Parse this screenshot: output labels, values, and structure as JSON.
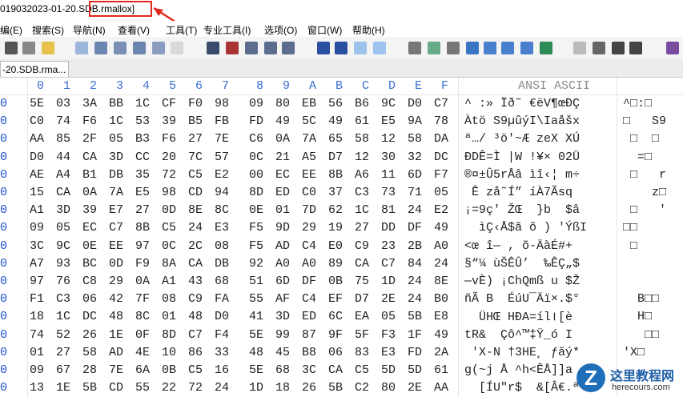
{
  "window": {
    "title": "019032023-01-20.SDB.rmallox]",
    "highlighted_text": "SDB.rmallox]"
  },
  "menu": [
    "编(E)",
    "搜索(S)",
    "导航(N)",
    "查看(V)",
    "工具(T)",
    "专业工具(I)",
    "选项(O)",
    "窗口(W)",
    "帮助(H)"
  ],
  "tab": {
    "label": "-20.SDB.rma..."
  },
  "hex_header": [
    "0",
    "1",
    "2",
    "3",
    "4",
    "5",
    "6",
    "7",
    "8",
    "9",
    "A",
    "B",
    "C",
    "D",
    "E",
    "F"
  ],
  "ascii_header": "ANSI ASCII",
  "rows": [
    {
      "offset": "0",
      "hex": [
        "5E",
        "03",
        "3A",
        "BB",
        "1C",
        "CF",
        "F0",
        "98",
        "09",
        "80",
        "EB",
        "56",
        "B6",
        "9C",
        "D0",
        "C7"
      ],
      "ansi": "^ :» Ïð˜ €ëV¶œÐÇ",
      "ascii": "^□:□"
    },
    {
      "offset": "0",
      "hex": [
        "C0",
        "74",
        "F6",
        "1C",
        "53",
        "39",
        "B5",
        "FB",
        "FD",
        "49",
        "5C",
        "49",
        "61",
        "E5",
        "9A",
        "78"
      ],
      "ansi": "Àtö S9µûýI\\Iaåšx",
      "ascii": "□   S9"
    },
    {
      "offset": "0",
      "hex": [
        "AA",
        "85",
        "2F",
        "05",
        "B3",
        "F6",
        "27",
        "7E",
        "C6",
        "0A",
        "7A",
        "65",
        "58",
        "12",
        "58",
        "DA"
      ],
      "ansi": "ª…/ ³ö'~Æ zeX XÚ",
      "ascii": " □  □"
    },
    {
      "offset": "0",
      "hex": [
        "D0",
        "44",
        "CA",
        "3D",
        "CC",
        "20",
        "7C",
        "57",
        "0C",
        "21",
        "A5",
        "D7",
        "12",
        "30",
        "32",
        "DC"
      ],
      "ansi": "ÐDÊ=Ì |W !¥× 02Ü",
      "ascii": "  =□"
    },
    {
      "offset": "0",
      "hex": [
        "AE",
        "A4",
        "B1",
        "DB",
        "35",
        "72",
        "C5",
        "E2",
        "00",
        "EC",
        "EE",
        "8B",
        "A6",
        "11",
        "6D",
        "F7"
      ],
      "ansi": "®¤±Û5rÅâ ìî‹¦ m÷",
      "ascii": " □   r"
    },
    {
      "offset": "0",
      "hex": [
        "15",
        "CA",
        "0A",
        "7A",
        "E5",
        "98",
        "CD",
        "94",
        "8D",
        "ED",
        "C0",
        "37",
        "C3",
        "73",
        "71",
        "05"
      ],
      "ansi": " Ê zå˜Í” íÀ7Ãsq ",
      "ascii": "    z□"
    },
    {
      "offset": "0",
      "hex": [
        "A1",
        "3D",
        "39",
        "E7",
        "27",
        "0D",
        "8E",
        "8C",
        "0E",
        "01",
        "7D",
        "62",
        "1C",
        "81",
        "24",
        "E2"
      ],
      "ansi": "¡=9ç' ŽŒ  }b  $â",
      "ascii": " □   '"
    },
    {
      "offset": "0",
      "hex": [
        "09",
        "05",
        "EC",
        "C7",
        "8B",
        "C5",
        "24",
        "E3",
        "F5",
        "9D",
        "29",
        "19",
        "27",
        "DD",
        "DF",
        "49"
      ],
      "ansi": "  ìÇ‹Å$ã õ ) 'ÝßI",
      "ascii": "□□"
    },
    {
      "offset": "0",
      "hex": [
        "3C",
        "9C",
        "0E",
        "EE",
        "97",
        "0C",
        "2C",
        "08",
        "F5",
        "AD",
        "C4",
        "E0",
        "C9",
        "23",
        "2B",
        "A0"
      ],
      "ansi": "<œ î— , õ-ÄàÉ#+ ",
      "ascii": " □"
    },
    {
      "offset": "0",
      "hex": [
        "A7",
        "93",
        "BC",
        "0D",
        "F9",
        "8A",
        "CA",
        "DB",
        "92",
        "A0",
        "A0",
        "89",
        "CA",
        "C7",
        "84",
        "24"
      ],
      "ansi": "§“¼ ùŠÊÛ’  ‰ÊÇ„$",
      "ascii": ""
    },
    {
      "offset": "0",
      "hex": [
        "97",
        "76",
        "C8",
        "29",
        "0A",
        "A1",
        "43",
        "68",
        "51",
        "6D",
        "DF",
        "0B",
        "75",
        "1D",
        "24",
        "8E"
      ],
      "ansi": "—vÈ) ¡ChQmß u $Ž",
      "ascii": ""
    },
    {
      "offset": "0",
      "hex": [
        "F1",
        "C3",
        "06",
        "42",
        "7F",
        "08",
        "C9",
        "FA",
        "55",
        "AF",
        "C4",
        "EF",
        "D7",
        "2E",
        "24",
        "B0"
      ],
      "ansi": "ñÃ B  ÉúU¯Äï×.$°",
      "ascii": "  B□□"
    },
    {
      "offset": "0",
      "hex": [
        "18",
        "1C",
        "DC",
        "48",
        "8C",
        "01",
        "48",
        "D0",
        "41",
        "3D",
        "ED",
        "6C",
        "EA",
        "05",
        "5B",
        "E8"
      ],
      "ansi": "  ÜHŒ HÐA=íl꠰[è",
      "ascii": "  H□"
    },
    {
      "offset": "0",
      "hex": [
        "74",
        "52",
        "26",
        "1E",
        "0F",
        "8D",
        "C7",
        "F4",
        "5E",
        "99",
        "87",
        "9F",
        "5F",
        "F3",
        "1F",
        "49"
      ],
      "ansi": "tR&  Çô^™‡Ÿ_ó I",
      "ascii": "   □□"
    },
    {
      "offset": "0",
      "hex": [
        "01",
        "27",
        "58",
        "AD",
        "4E",
        "10",
        "86",
        "33",
        "48",
        "45",
        "B8",
        "06",
        "83",
        "E3",
        "FD",
        "2A"
      ],
      "ansi": " 'X-N †3HE¸ ƒãý*",
      "ascii": "'X□"
    },
    {
      "offset": "0",
      "hex": [
        "09",
        "67",
        "28",
        "7E",
        "6A",
        "0B",
        "C5",
        "16",
        "5E",
        "68",
        "3C",
        "CA",
        "C5",
        "5D",
        "5D",
        "61"
      ],
      "ansi": "g(~j Å ^h<ÊÅ]]a",
      "ascii": ""
    },
    {
      "offset": "0",
      "hex": [
        "13",
        "1E",
        "5B",
        "CD",
        "55",
        "22",
        "72",
        "24",
        "1D",
        "18",
        "26",
        "5B",
        "C2",
        "80",
        "2E",
        "AA"
      ],
      "ansi": "  [ÍU\"r$  &[Â€.ª",
      "ascii": ""
    }
  ],
  "watermark": {
    "title": "这里教程网",
    "subtitle": "herecours.com",
    "logo_letter": "Z"
  },
  "colors": {
    "highlight_box": "#e0281c",
    "hex_header": "#3a6fd0",
    "offset": "#1d4fd0",
    "ascii_header": "#8c8c8c"
  },
  "icons": [
    "open-icon",
    "properties-icon",
    "save-icon",
    "undo-icon",
    "copy-icon",
    "paste-icon",
    "paste-special-icon",
    "clipboard-icon",
    "hex-icon",
    "binoculars-icon",
    "find-hex-icon",
    "replace-icon",
    "replace-hex-icon",
    "goto-icon",
    "goto-offset-icon",
    "back-icon",
    "forward-icon",
    "disk-icon",
    "disk-open-icon",
    "ram-icon",
    "calculator-icon",
    "search-icon",
    "list-icon",
    "grid-icon",
    "image-icon",
    "first-icon",
    "next-icon",
    "book-icon"
  ]
}
